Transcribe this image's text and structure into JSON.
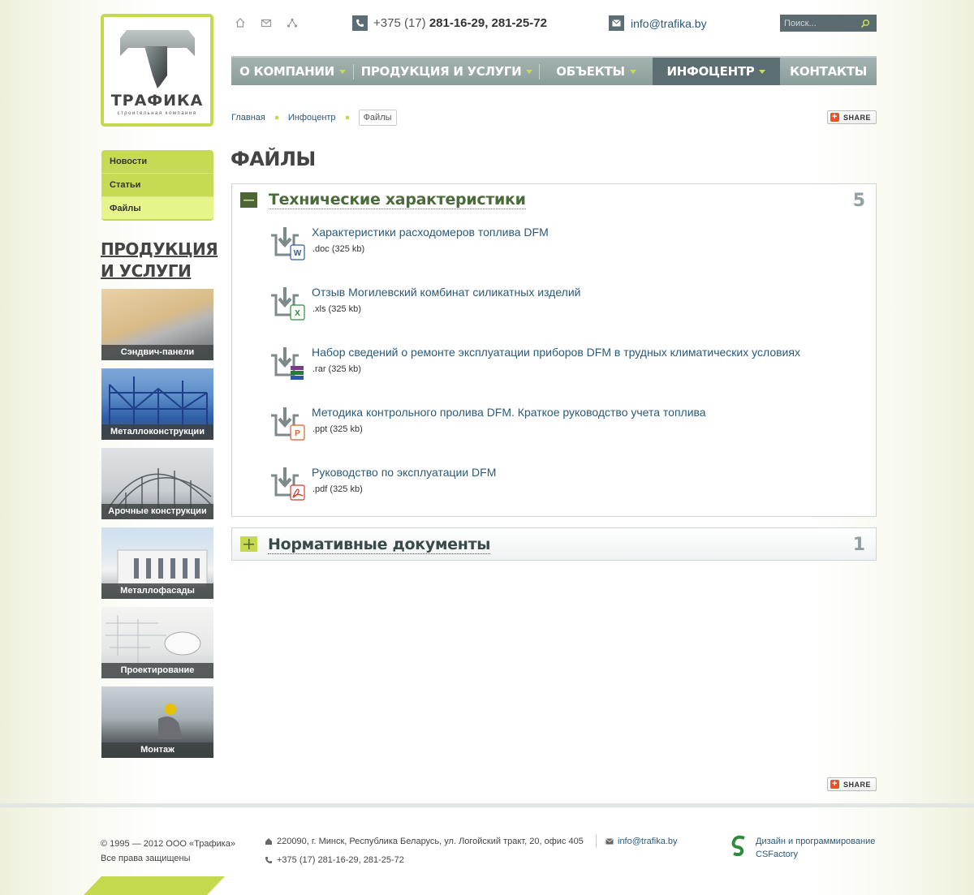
{
  "logo": {
    "name": "ТРАФИКА",
    "subtitle": "строительная компания"
  },
  "header": {
    "phone_prefix": "+375 (17)",
    "phone_numbers": "281-16-29, 281-25-72",
    "email": "info@trafika.by",
    "search_placeholder": "Поиск..."
  },
  "nav": {
    "items": [
      {
        "label": "О КОМПАНИИ"
      },
      {
        "label": "ПРОДУКЦИЯ И УСЛУГИ"
      },
      {
        "label": "ОБЪЕКТЫ"
      },
      {
        "label": "ИНФОЦЕНТР"
      },
      {
        "label": "КОНТАКТЫ"
      }
    ]
  },
  "breadcrumb": {
    "home": "Главная",
    "section": "Инфоцентр",
    "current": "Файлы"
  },
  "share_label": "SHARE",
  "page_title": "ФАЙЛЫ",
  "sidebar": {
    "items": [
      {
        "label": "Новости"
      },
      {
        "label": "Статьи"
      },
      {
        "label": "Файлы"
      }
    ],
    "products_heading_1": "ПРОДУКЦИЯ",
    "products_heading_2": "И УСЛУГИ",
    "products": [
      {
        "label": "Сэндвич-панели"
      },
      {
        "label": "Металлоконструкции"
      },
      {
        "label": "Арочные конструкции"
      },
      {
        "label": "Металлофасады"
      },
      {
        "label": "Проектирование"
      },
      {
        "label": "Монтаж"
      }
    ]
  },
  "accordion": [
    {
      "title": "Технические характеристики",
      "count": "5",
      "files": [
        {
          "name": "Характеристики расходомеров топлива DFM",
          "meta": ".doc (325 kb)",
          "type": "doc",
          "badge_color": "#2b5aa8"
        },
        {
          "name": "Отзыв Могилевский комбинат силикатных изделий",
          "meta": ".xls (325 kb)",
          "type": "xls",
          "badge_color": "#2e8b3a"
        },
        {
          "name": "Набор сведений о ремонте эксплуатации приборов DFM в трудных климатических условиях",
          "meta": ".rar (325 kb)",
          "type": "rar",
          "badge_color": "#7a3b8f"
        },
        {
          "name": "Методика контрольного пролива DFM. Краткое руководство учета топлива",
          "meta": ".ppt (325 kb)",
          "type": "ppt",
          "badge_color": "#d9622b"
        },
        {
          "name": "Руководство по эксплуатации DFM",
          "meta": ".pdf (325 kb)",
          "type": "pdf",
          "badge_color": "#d23b2b"
        }
      ]
    },
    {
      "title": "Нормативные документы",
      "count": "1"
    }
  ],
  "footer": {
    "copyright": "© 1995 — 2012 ООО «Трафика»",
    "rights": "Все права защищены",
    "address": "220090, г. Минск, Республика Беларусь, ул. Логойский тракт, 20, офис 405",
    "email": "info@trafika.by",
    "phone": "+375 (17) 281-16-29, 281-25-72",
    "dev_line1": "Дизайн и программирование",
    "dev_line2": "CSFactory"
  },
  "colors": {
    "accent_green": "#c5d84e",
    "nav_gray": "#8b9d9a",
    "nav_active": "#5c6e72",
    "link": "#2a5a7a"
  }
}
